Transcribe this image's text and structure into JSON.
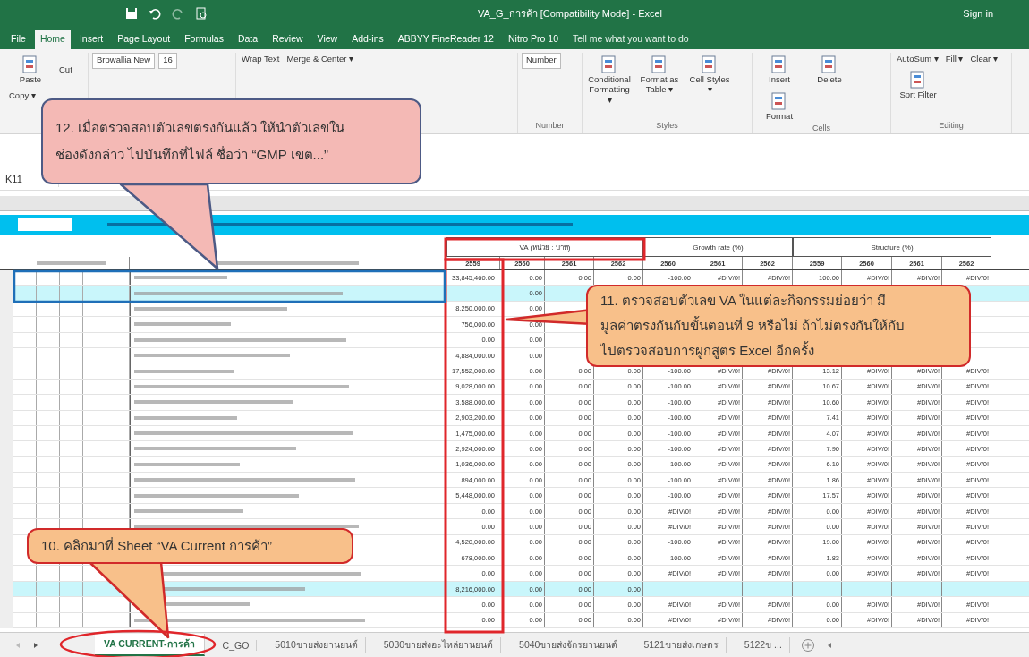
{
  "window": {
    "title": "VA_G_การค้า [Compatibility Mode] - Excel",
    "sign_in": "Sign in"
  },
  "menu_tabs": [
    {
      "label": "File",
      "selected": false
    },
    {
      "label": "Home",
      "selected": true
    },
    {
      "label": "Insert",
      "selected": false
    },
    {
      "label": "Page Layout",
      "selected": false
    },
    {
      "label": "Formulas",
      "selected": false
    },
    {
      "label": "Data",
      "selected": false
    },
    {
      "label": "Review",
      "selected": false
    },
    {
      "label": "View",
      "selected": false
    },
    {
      "label": "Add-ins",
      "selected": false
    },
    {
      "label": "ABBYY FineReader 12",
      "selected": false
    },
    {
      "label": "Nitro Pro 10",
      "selected": false
    }
  ],
  "tell_me": "Tell me what you want to do",
  "ribbon": {
    "groups": [
      {
        "items": [
          {
            "kind": "large",
            "label": "Paste"
          },
          {
            "kind": "small",
            "label": "Cut"
          },
          {
            "kind": "small",
            "label": "Copy ▾"
          }
        ]
      },
      {
        "items": [
          {
            "kind": "field",
            "label": "Browallia New"
          },
          {
            "kind": "field",
            "label": "16"
          }
        ]
      },
      {
        "items": [
          {
            "kind": "small",
            "label": "Wrap Text"
          },
          {
            "kind": "small",
            "label": "Merge & Center ▾"
          }
        ]
      },
      {
        "label": "Number",
        "items": [
          {
            "kind": "field",
            "label": "Number"
          }
        ]
      },
      {
        "label": "Styles",
        "items": [
          {
            "kind": "large",
            "label": "Conditional Formatting ▾"
          },
          {
            "kind": "large",
            "label": "Format as Table ▾"
          },
          {
            "kind": "large",
            "label": "Cell Styles ▾"
          }
        ]
      },
      {
        "label": "Cells",
        "items": [
          {
            "kind": "large",
            "label": "Insert"
          },
          {
            "kind": "large",
            "label": "Delete"
          },
          {
            "kind": "large",
            "label": "Format"
          }
        ]
      },
      {
        "label": "Editing",
        "items": [
          {
            "kind": "small",
            "label": "AutoSum ▾"
          },
          {
            "kind": "small",
            "label": "Fill ▾"
          },
          {
            "kind": "small",
            "label": "Clear ▾"
          },
          {
            "kind": "large",
            "label": "Sort Filter"
          }
        ]
      }
    ]
  },
  "name_box": "K11",
  "sheet": {
    "group_headers": [
      "VA (หน่วย : บาท)",
      "Growth rate (%)",
      "Structure (%)"
    ],
    "va_years": [
      "2559",
      "2560",
      "2561",
      "2562"
    ],
    "growth_years": [
      "2560",
      "2561",
      "2562"
    ],
    "structure_years": [
      "2559",
      "2560",
      "2561",
      "2562"
    ],
    "rows": [
      {
        "highlighted": false,
        "va1": "33,845,460.00",
        "va2": "0.00",
        "va3": "0.00",
        "va4": "0.00",
        "g1": "-100.00",
        "g2": "#DIV/0!",
        "g3": "#DIV/0!",
        "s1": "100.00",
        "s2": "#DIV/0!",
        "s3": "#DIV/0!",
        "s4": "#DIV/0!"
      },
      {
        "highlighted": true,
        "va2": "0.00"
      },
      {
        "highlighted": false,
        "va1": "8,250,000.00",
        "va2": "0.00"
      },
      {
        "highlighted": false,
        "va1": "756,000.00",
        "va2": "0.00"
      },
      {
        "highlighted": false,
        "va1": "0.00",
        "va2": "0.00"
      },
      {
        "highlighted": false,
        "va1": "4,884,000.00",
        "va2": "0.00"
      },
      {
        "highlighted": false,
        "va1": "17,552,000.00",
        "va2": "0.00",
        "va3": "0.00",
        "va4": "0.00",
        "g1": "-100.00",
        "g2": "#DIV/0!",
        "g3": "#DIV/0!",
        "s1": "13.12",
        "s2": "#DIV/0!",
        "s3": "#DIV/0!",
        "s4": "#DIV/0!"
      },
      {
        "highlighted": false,
        "va1": "9,028,000.00",
        "va2": "0.00",
        "va3": "0.00",
        "va4": "0.00",
        "g1": "-100.00",
        "g2": "#DIV/0!",
        "g3": "#DIV/0!",
        "s1": "10.67",
        "s2": "#DIV/0!",
        "s3": "#DIV/0!",
        "s4": "#DIV/0!"
      },
      {
        "highlighted": false,
        "va1": "3,588,000.00",
        "va2": "0.00",
        "va3": "0.00",
        "va4": "0.00",
        "g1": "-100.00",
        "g2": "#DIV/0!",
        "g3": "#DIV/0!",
        "s1": "10.60",
        "s2": "#DIV/0!",
        "s3": "#DIV/0!",
        "s4": "#DIV/0!"
      },
      {
        "highlighted": false,
        "va1": "2,903,200.00",
        "va2": "0.00",
        "va3": "0.00",
        "va4": "0.00",
        "g1": "-100.00",
        "g2": "#DIV/0!",
        "g3": "#DIV/0!",
        "s1": "7.41",
        "s2": "#DIV/0!",
        "s3": "#DIV/0!",
        "s4": "#DIV/0!"
      },
      {
        "highlighted": false,
        "va1": "1,475,000.00",
        "va2": "0.00",
        "va3": "0.00",
        "va4": "0.00",
        "g1": "-100.00",
        "g2": "#DIV/0!",
        "g3": "#DIV/0!",
        "s1": "4.07",
        "s2": "#DIV/0!",
        "s3": "#DIV/0!",
        "s4": "#DIV/0!"
      },
      {
        "highlighted": false,
        "va1": "2,924,000.00",
        "va2": "0.00",
        "va3": "0.00",
        "va4": "0.00",
        "g1": "-100.00",
        "g2": "#DIV/0!",
        "g3": "#DIV/0!",
        "s1": "7.90",
        "s2": "#DIV/0!",
        "s3": "#DIV/0!",
        "s4": "#DIV/0!"
      },
      {
        "highlighted": false,
        "va1": "1,036,000.00",
        "va2": "0.00",
        "va3": "0.00",
        "va4": "0.00",
        "g1": "-100.00",
        "g2": "#DIV/0!",
        "g3": "#DIV/0!",
        "s1": "6.10",
        "s2": "#DIV/0!",
        "s3": "#DIV/0!",
        "s4": "#DIV/0!"
      },
      {
        "highlighted": false,
        "va1": "894,000.00",
        "va2": "0.00",
        "va3": "0.00",
        "va4": "0.00",
        "g1": "-100.00",
        "g2": "#DIV/0!",
        "g3": "#DIV/0!",
        "s1": "1.86",
        "s2": "#DIV/0!",
        "s3": "#DIV/0!",
        "s4": "#DIV/0!"
      },
      {
        "highlighted": false,
        "va1": "5,448,000.00",
        "va2": "0.00",
        "va3": "0.00",
        "va4": "0.00",
        "g1": "-100.00",
        "g2": "#DIV/0!",
        "g3": "#DIV/0!",
        "s1": "17.57",
        "s2": "#DIV/0!",
        "s3": "#DIV/0!",
        "s4": "#DIV/0!"
      },
      {
        "highlighted": false,
        "va1": "0.00",
        "va2": "0.00",
        "va3": "0.00",
        "va4": "0.00",
        "g1": "#DIV/0!",
        "g2": "#DIV/0!",
        "g3": "#DIV/0!",
        "s1": "0.00",
        "s2": "#DIV/0!",
        "s3": "#DIV/0!",
        "s4": "#DIV/0!"
      },
      {
        "highlighted": false,
        "va1": "0.00",
        "va2": "0.00",
        "va3": "0.00",
        "va4": "0.00",
        "g1": "#DIV/0!",
        "g2": "#DIV/0!",
        "g3": "#DIV/0!",
        "s1": "0.00",
        "s2": "#DIV/0!",
        "s3": "#DIV/0!",
        "s4": "#DIV/0!"
      },
      {
        "highlighted": false,
        "va1": "4,520,000.00",
        "va2": "0.00",
        "va3": "0.00",
        "va4": "0.00",
        "g1": "-100.00",
        "g2": "#DIV/0!",
        "g3": "#DIV/0!",
        "s1": "19.00",
        "s2": "#DIV/0!",
        "s3": "#DIV/0!",
        "s4": "#DIV/0!"
      },
      {
        "highlighted": false,
        "va1": "678,000.00",
        "va2": "0.00",
        "va3": "0.00",
        "va4": "0.00",
        "g1": "-100.00",
        "g2": "#DIV/0!",
        "g3": "#DIV/0!",
        "s1": "1.83",
        "s2": "#DIV/0!",
        "s3": "#DIV/0!",
        "s4": "#DIV/0!"
      },
      {
        "highlighted": false,
        "va1": "0.00",
        "va2": "0.00",
        "va3": "0.00",
        "va4": "0.00",
        "g1": "#DIV/0!",
        "g2": "#DIV/0!",
        "g3": "#DIV/0!",
        "s1": "0.00",
        "s2": "#DIV/0!",
        "s3": "#DIV/0!",
        "s4": "#DIV/0!"
      },
      {
        "highlighted": true,
        "va1": "8,216,000.00",
        "va2": "0.00",
        "va3": "0.00",
        "va4": "0.00"
      },
      {
        "highlighted": false,
        "va1": "0.00",
        "va2": "0.00",
        "va3": "0.00",
        "va4": "0.00",
        "g1": "#DIV/0!",
        "g2": "#DIV/0!",
        "g3": "#DIV/0!",
        "s1": "0.00",
        "s2": "#DIV/0!",
        "s3": "#DIV/0!",
        "s4": "#DIV/0!"
      },
      {
        "highlighted": false,
        "va1": "0.00",
        "va2": "0.00",
        "va3": "0.00",
        "va4": "0.00",
        "g1": "#DIV/0!",
        "g2": "#DIV/0!",
        "g3": "#DIV/0!",
        "s1": "0.00",
        "s2": "#DIV/0!",
        "s3": "#DIV/0!",
        "s4": "#DIV/0!"
      }
    ]
  },
  "sheet_tabs": [
    {
      "label": "VA CURRENT-การค้า",
      "selected": true
    },
    {
      "label": "C_GO",
      "selected": false
    },
    {
      "label": "5010ขายส่งยานยนต์",
      "selected": false
    },
    {
      "label": "5030ขายส่งอะไหล่ยานยนต์",
      "selected": false
    },
    {
      "label": "5040ขายส่งจักรยานยนต์",
      "selected": false
    },
    {
      "label": "5121ขายส่งเกษตร",
      "selected": false
    },
    {
      "label": "5122ข ...",
      "selected": false
    }
  ],
  "callouts": [
    {
      "kind": "pink",
      "lines": [
        "12. เมื่อตรวจสอบตัวเลขตรงกันแล้ว ให้นำตัวเลขใน",
        "ช่องดังกล่าว ไปบันทึกที่ไฟล์ ชื่อว่า “GMP เขต...”"
      ]
    },
    {
      "kind": "orange",
      "lines": [
        "11. ตรวจสอบตัวเลข VA ในแต่ละกิจกรรมย่อยว่า มี",
        "มูลค่าตรงกันกับขั้นตอนที่ 9 หรือไม่ ถ้าไม่ตรงกันให้กับ",
        "ไปตรวจสอบการผูกสูตร Excel อีกครั้ง"
      ]
    },
    {
      "kind": "orange",
      "lines": [
        "10. คลิกมาที่ Sheet “VA Current การค้า”"
      ]
    }
  ]
}
